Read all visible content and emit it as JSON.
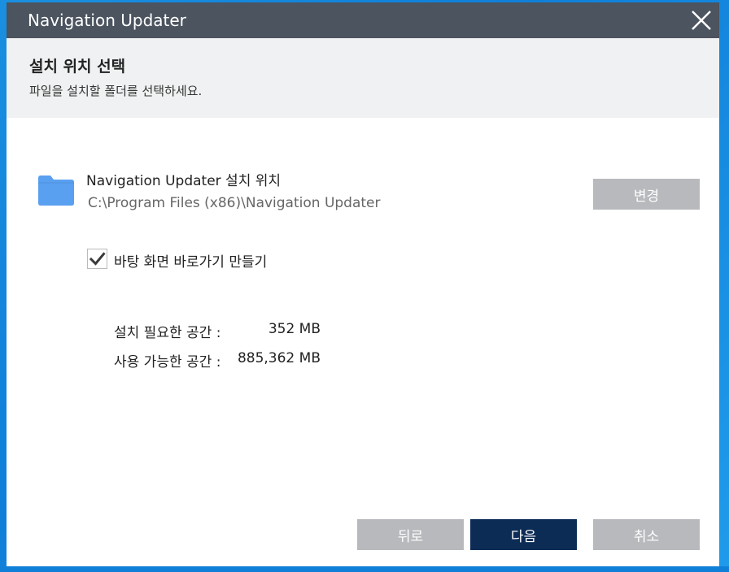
{
  "window": {
    "title": "Navigation Updater"
  },
  "header": {
    "title": "설치 위치 선택",
    "subtitle": "파일을 설치할 폴더를 선택하세요."
  },
  "location": {
    "label": "Navigation Updater 설치 위치",
    "path": "C:\\Program Files (x86)\\Navigation Updater",
    "change_label": "변경"
  },
  "shortcut": {
    "label": "바탕 화면 바로가기 만들기",
    "checked": true
  },
  "space": {
    "required_label": "설치 필요한 공간 :",
    "required_value": "352 MB",
    "available_label": "사용 가능한 공간 :",
    "available_value": "885,362 MB"
  },
  "buttons": {
    "back": "뒤로",
    "next": "다음",
    "cancel": "취소"
  },
  "colors": {
    "titlebar": "#4b545f",
    "primary": "#0c2c56",
    "disabled": "#b7b9bc",
    "folder": "#5aa0f0",
    "desktop": "#1a8fe0"
  },
  "icons": {
    "close": "close-icon",
    "folder": "folder-icon",
    "check": "checkmark-icon"
  }
}
